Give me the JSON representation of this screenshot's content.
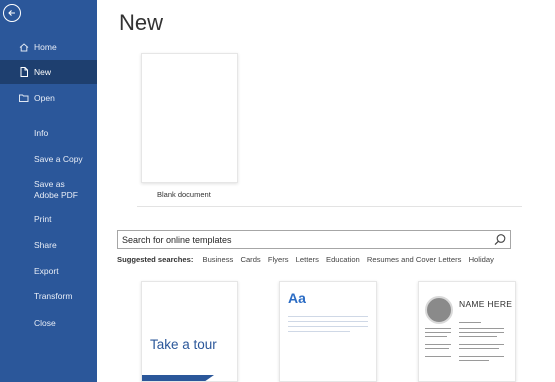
{
  "sidebar": {
    "items": [
      {
        "label": "Home",
        "icon": "home-icon"
      },
      {
        "label": "New",
        "icon": "new-document-icon",
        "active": true
      },
      {
        "label": "Open",
        "icon": "folder-open-icon"
      },
      {
        "label": "Info"
      },
      {
        "label": "Save a Copy"
      },
      {
        "label": "Save as Adobe PDF"
      },
      {
        "label": "Print"
      },
      {
        "label": "Share"
      },
      {
        "label": "Export"
      },
      {
        "label": "Transform"
      },
      {
        "label": "Close"
      }
    ]
  },
  "main": {
    "title": "New",
    "blank_document_label": "Blank document",
    "search": {
      "placeholder": "Search for online templates",
      "icon": "search-icon"
    },
    "suggested": {
      "heading": "Suggested searches:",
      "tags": [
        "Business",
        "Cards",
        "Flyers",
        "Letters",
        "Education",
        "Resumes and Cover Letters",
        "Holiday"
      ]
    },
    "templates": {
      "tour_text": "Take a tour",
      "aa_text": "Aa",
      "resume_name": "NAME HERE"
    }
  },
  "colors": {
    "sidebar_bg": "#2b579a",
    "sidebar_active": "#1e3f6f",
    "accent": "#2b579a"
  }
}
